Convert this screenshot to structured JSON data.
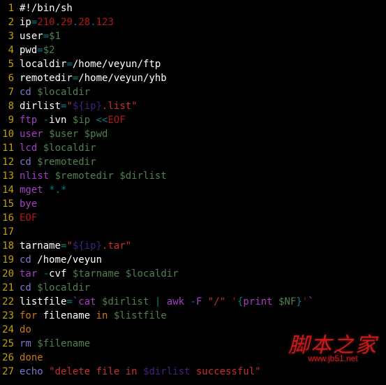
{
  "lines": [
    [
      {
        "c": "c-white",
        "t": "#!/bin/sh"
      }
    ],
    [
      {
        "c": "c-white",
        "t": "ip"
      },
      {
        "c": "c-teal",
        "t": "="
      },
      {
        "c": "c-red",
        "t": "210"
      },
      {
        "c": "c-teal",
        "t": "."
      },
      {
        "c": "c-red",
        "t": "29"
      },
      {
        "c": "c-teal",
        "t": "."
      },
      {
        "c": "c-red",
        "t": "28"
      },
      {
        "c": "c-teal",
        "t": "."
      },
      {
        "c": "c-red",
        "t": "123"
      }
    ],
    [
      {
        "c": "c-white",
        "t": "user"
      },
      {
        "c": "c-teal",
        "t": "="
      },
      {
        "c": "c-var",
        "t": "$1"
      }
    ],
    [
      {
        "c": "c-white",
        "t": "pwd"
      },
      {
        "c": "c-teal",
        "t": "="
      },
      {
        "c": "c-var",
        "t": "$2"
      }
    ],
    [
      {
        "c": "c-white",
        "t": "localdir"
      },
      {
        "c": "c-teal",
        "t": "="
      },
      {
        "c": "c-white",
        "t": "/home/veyun/ftp"
      }
    ],
    [
      {
        "c": "c-white",
        "t": "remotedir"
      },
      {
        "c": "c-teal",
        "t": "="
      },
      {
        "c": "c-white",
        "t": "/home/veyun/yhb"
      }
    ],
    [
      {
        "c": "c-cmd",
        "t": "cd"
      },
      {
        "c": "c-white",
        "t": " "
      },
      {
        "c": "c-var",
        "t": "$localdir"
      }
    ],
    [
      {
        "c": "c-white",
        "t": "dirlist"
      },
      {
        "c": "c-teal",
        "t": "="
      },
      {
        "c": "c-red2",
        "t": "\""
      },
      {
        "c": "c-deep",
        "t": "${ip}"
      },
      {
        "c": "c-red2",
        "t": ".list\""
      }
    ],
    [
      {
        "c": "c-purp",
        "t": "ftp"
      },
      {
        "c": "c-white",
        "t": " "
      },
      {
        "c": "c-teal",
        "t": "-"
      },
      {
        "c": "c-white",
        "t": "ivn "
      },
      {
        "c": "c-var",
        "t": "$ip"
      },
      {
        "c": "c-white",
        "t": " "
      },
      {
        "c": "c-teal",
        "t": "<<"
      },
      {
        "c": "c-red",
        "t": "EOF"
      }
    ],
    [
      {
        "c": "c-purp",
        "t": "user"
      },
      {
        "c": "c-white",
        "t": " "
      },
      {
        "c": "c-var",
        "t": "$user"
      },
      {
        "c": "c-white",
        "t": " "
      },
      {
        "c": "c-var",
        "t": "$pwd"
      }
    ],
    [
      {
        "c": "c-purp",
        "t": "lcd"
      },
      {
        "c": "c-white",
        "t": " "
      },
      {
        "c": "c-var",
        "t": "$localdir"
      }
    ],
    [
      {
        "c": "c-cmd",
        "t": "cd"
      },
      {
        "c": "c-white",
        "t": " "
      },
      {
        "c": "c-var",
        "t": "$remotedir"
      }
    ],
    [
      {
        "c": "c-purp",
        "t": "nlist"
      },
      {
        "c": "c-white",
        "t": " "
      },
      {
        "c": "c-var",
        "t": "$remotedir"
      },
      {
        "c": "c-white",
        "t": " "
      },
      {
        "c": "c-var",
        "t": "$dirlist"
      }
    ],
    [
      {
        "c": "c-purp",
        "t": "mget"
      },
      {
        "c": "c-white",
        "t": " "
      },
      {
        "c": "c-teal",
        "t": "*.*"
      }
    ],
    [
      {
        "c": "c-purp",
        "t": "bye"
      }
    ],
    [
      {
        "c": "c-red",
        "t": "EOF"
      }
    ],
    [
      {
        "c": "c-white",
        "t": ""
      }
    ],
    [
      {
        "c": "c-white",
        "t": "tarname"
      },
      {
        "c": "c-teal",
        "t": "="
      },
      {
        "c": "c-red2",
        "t": "\""
      },
      {
        "c": "c-deep",
        "t": "${ip}"
      },
      {
        "c": "c-red2",
        "t": ".tar\""
      }
    ],
    [
      {
        "c": "c-cmd",
        "t": "cd"
      },
      {
        "c": "c-white",
        "t": " /home/veyun"
      }
    ],
    [
      {
        "c": "c-purp",
        "t": "tar"
      },
      {
        "c": "c-white",
        "t": " "
      },
      {
        "c": "c-teal",
        "t": "-"
      },
      {
        "c": "c-white",
        "t": "cvf "
      },
      {
        "c": "c-var",
        "t": "$tarname"
      },
      {
        "c": "c-white",
        "t": " "
      },
      {
        "c": "c-var",
        "t": "$localdir"
      }
    ],
    [
      {
        "c": "c-cmd",
        "t": "cd"
      },
      {
        "c": "c-white",
        "t": " "
      },
      {
        "c": "c-var",
        "t": "$localdir"
      }
    ],
    [
      {
        "c": "c-white",
        "t": "listfile"
      },
      {
        "c": "c-teal",
        "t": "="
      },
      {
        "c": "c-purp",
        "t": "`cat "
      },
      {
        "c": "c-var",
        "t": "$dirlist"
      },
      {
        "c": "c-purp",
        "t": " "
      },
      {
        "c": "c-teal",
        "t": "|"
      },
      {
        "c": "c-purp",
        "t": " awk "
      },
      {
        "c": "c-teal",
        "t": "-"
      },
      {
        "c": "c-purp",
        "t": "F "
      },
      {
        "c": "c-red2",
        "t": "\"/\""
      },
      {
        "c": "c-purp",
        "t": " "
      },
      {
        "c": "c-red",
        "t": "'"
      },
      {
        "c": "c-teal",
        "t": "{"
      },
      {
        "c": "c-purp",
        "t": "print "
      },
      {
        "c": "c-var",
        "t": "$NF"
      },
      {
        "c": "c-teal",
        "t": "}"
      },
      {
        "c": "c-red",
        "t": "'"
      },
      {
        "c": "c-purp",
        "t": "`"
      }
    ],
    [
      {
        "c": "c-orange",
        "t": "for"
      },
      {
        "c": "c-white",
        "t": " filename "
      },
      {
        "c": "c-orange",
        "t": "in"
      },
      {
        "c": "c-white",
        "t": " "
      },
      {
        "c": "c-var",
        "t": "$listfile"
      }
    ],
    [
      {
        "c": "c-orange",
        "t": "do"
      }
    ],
    [
      {
        "c": "c-cmd",
        "t": "rm"
      },
      {
        "c": "c-white",
        "t": " "
      },
      {
        "c": "c-var",
        "t": "$filename"
      }
    ],
    [
      {
        "c": "c-orange",
        "t": "done"
      }
    ],
    [
      {
        "c": "c-cmd",
        "t": "echo"
      },
      {
        "c": "c-white",
        "t": " "
      },
      {
        "c": "c-red2",
        "t": "\"delete file in "
      },
      {
        "c": "c-deep",
        "t": "$dirlist"
      },
      {
        "c": "c-red2",
        "t": " successful\""
      }
    ]
  ],
  "watermark": {
    "main": "脚本之家",
    "sub": "www.jb51.net"
  }
}
